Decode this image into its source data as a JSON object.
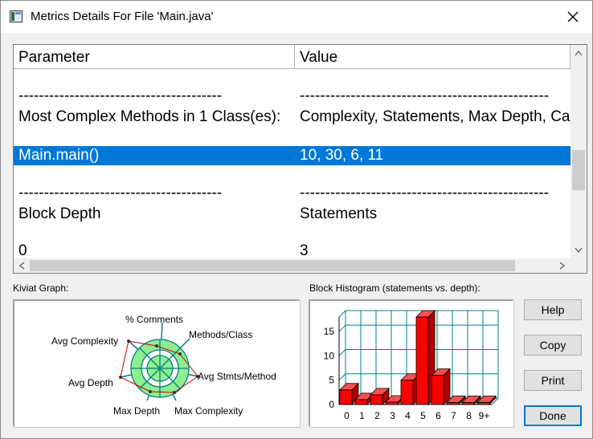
{
  "window": {
    "title": "Metrics Details For File 'Main.java'"
  },
  "table": {
    "headers": {
      "parameter": "Parameter",
      "value": "Value"
    },
    "rows": [
      {
        "parameter": "----------------------------------------",
        "value": "-------------------------------------------------"
      },
      {
        "parameter": "Most Complex Methods in 1 Class(es):",
        "value": "Complexity, Statements, Max Depth, Calls"
      },
      {
        "parameter": "Main.main()",
        "value": "10, 30, 6, 11",
        "selected": true
      },
      {
        "parameter": "----------------------------------------",
        "value": "-------------------------------------------------"
      },
      {
        "parameter": "Block Depth",
        "value": "Statements"
      },
      {
        "parameter": "0",
        "value": "3"
      }
    ]
  },
  "kiviat": {
    "label": "Kiviat Graph:",
    "axes": [
      "% Comments",
      "Methods/Class",
      "Avg Stmts/Method",
      "Max Complexity",
      "Max Depth",
      "Avg Depth",
      "Avg Complexity"
    ]
  },
  "histogram": {
    "label": "Block Histogram (statements vs. depth):"
  },
  "buttons": {
    "help": "Help",
    "copy": "Copy",
    "print": "Print",
    "done": "Done"
  },
  "colors": {
    "selection": "#0078d7",
    "bar": "#ff0000",
    "grid": "#008080",
    "kiviat_fill": "#90ee90"
  },
  "chart_data": {
    "type": "bar",
    "categories": [
      "0",
      "1",
      "2",
      "3",
      "4",
      "5",
      "6",
      "7",
      "8",
      "9+"
    ],
    "values": [
      3,
      1,
      2,
      0.5,
      5,
      18,
      6,
      0.4,
      0.4,
      0.4
    ],
    "yticks": [
      0,
      5,
      10,
      15
    ],
    "ylim": [
      0,
      18
    ],
    "grid": true
  }
}
